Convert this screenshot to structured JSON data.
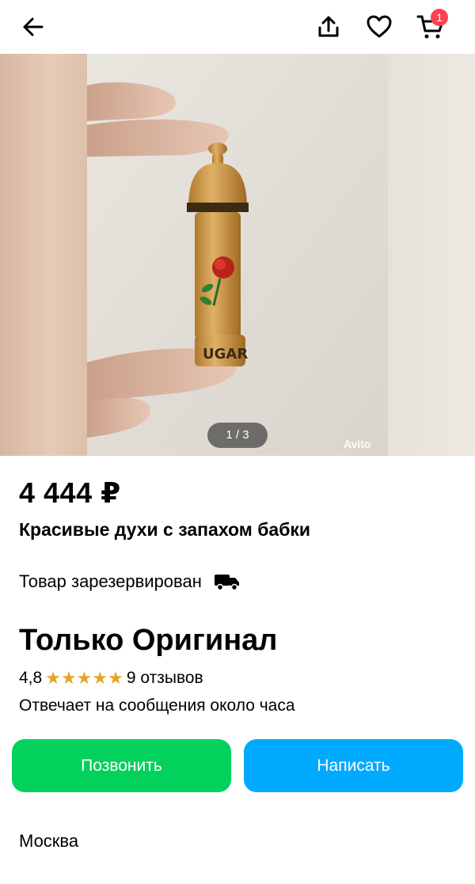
{
  "cart": {
    "badge_count": "1"
  },
  "gallery": {
    "counter": "1 / 3",
    "watermark": "Avito"
  },
  "listing": {
    "price": "4 444 ₽",
    "title": "Красивые духи с запахом бабки",
    "status": "Товар зарезервирован"
  },
  "seller": {
    "name": "Только Оригинал",
    "rating": "4,8",
    "stars": 5,
    "reviews": "9 отзывов",
    "response_time": "Отвечает на сообщения около часа"
  },
  "actions": {
    "call_label": "Позвонить",
    "write_label": "Написать"
  },
  "location": {
    "city": "Москва"
  },
  "colors": {
    "call": "#02d15c",
    "write": "#00aaff",
    "badge": "#ff4053",
    "star": "#e6a428"
  },
  "icons": [
    "arrow-left-icon",
    "share-icon",
    "heart-icon",
    "cart-icon",
    "truck-icon",
    "star-icon"
  ]
}
